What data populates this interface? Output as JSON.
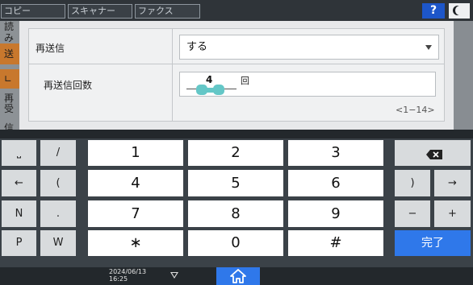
{
  "topbar": {
    "tabs": [
      "コピー",
      "スキャナー",
      "ファクス"
    ],
    "help_label": "?"
  },
  "left_strip": {
    "items": [
      "読み",
      "送信",
      "∟再",
      "受信"
    ]
  },
  "setting": {
    "resend_label": "再送信",
    "resend_value": "する",
    "count_label": "再送信回数",
    "count_value": "4",
    "count_unit": "回",
    "range_text": "<1−14>"
  },
  "keyboard": {
    "left_keys": [
      [
        "⎵",
        "/"
      ],
      [
        "←",
        "("
      ],
      [
        "N",
        "."
      ],
      [
        "P",
        "W"
      ]
    ],
    "num_keys": [
      [
        "1",
        "2",
        "3"
      ],
      [
        "4",
        "5",
        "6"
      ],
      [
        "7",
        "8",
        "9"
      ],
      [
        "∗",
        "0",
        "#"
      ]
    ],
    "right_keys": [
      [
        ")",
        "→"
      ],
      [
        "−",
        "+"
      ]
    ],
    "done_label": "完了"
  },
  "statusbar": {
    "date": "2024/06/13",
    "time": "16:25"
  },
  "colors": {
    "accent": "#2f78ea",
    "help": "#1d56c9",
    "highlight": "#64c7c7",
    "orange": "#c8782d"
  }
}
